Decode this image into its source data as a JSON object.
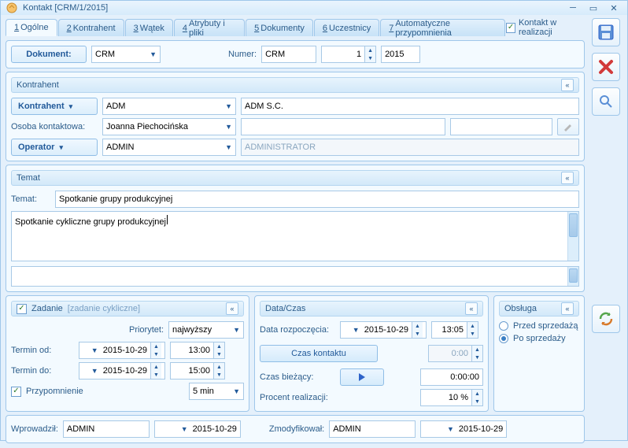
{
  "window": {
    "title": "Kontakt [CRM/1/2015]"
  },
  "realization": {
    "label": "Kontakt w realizacji",
    "checked": true
  },
  "tabs": [
    {
      "num": "1",
      "label": "Ogólne"
    },
    {
      "num": "2",
      "label": "Kontrahent"
    },
    {
      "num": "3",
      "label": "Wątek"
    },
    {
      "num": "4",
      "label": "Atrybuty i pliki"
    },
    {
      "num": "5",
      "label": "Dokumenty"
    },
    {
      "num": "6",
      "label": "Uczestnicy"
    },
    {
      "num": "7",
      "label": "Automatyczne przypomnienia"
    }
  ],
  "doc": {
    "dokument_label": "Dokument:",
    "dokument_value": "CRM",
    "numer_label": "Numer:",
    "numer_series": "CRM",
    "numer_value": "1",
    "year": "2015"
  },
  "kontrahent": {
    "header": "Kontrahent",
    "kontrahent_btn": "Kontrahent",
    "kontrahent_code": "ADM",
    "kontrahent_name": "ADM S.C.",
    "osoba_label": "Osoba kontaktowa:",
    "osoba_value": "Joanna Piechocińska",
    "operator_btn": "Operator",
    "operator_code": "ADMIN",
    "operator_name": "ADMINISTRATOR"
  },
  "temat": {
    "header": "Temat",
    "label": "Temat:",
    "value": "Spotkanie grupy produkcyjnej",
    "body": "Spotkanie cykliczne grupy produkcyjnej"
  },
  "zadanie": {
    "header": "Zadanie",
    "subheader": "[zadanie cykliczne]",
    "checked": true,
    "priorytet_label": "Priorytet:",
    "priorytet_value": "najwyższy",
    "termin_od_label": "Termin od:",
    "termin_od_date": "2015-10-29",
    "termin_od_time": "13:00",
    "termin_do_label": "Termin do:",
    "termin_do_date": "2015-10-29",
    "termin_do_time": "15:00",
    "przypomnienie_label": "Przypomnienie",
    "przypomnienie_checked": true,
    "przypomnienie_value": "5 min"
  },
  "dataczas": {
    "header": "Data/Czas",
    "rozp_label": "Data rozpoczęcia:",
    "rozp_date": "2015-10-29",
    "rozp_time": "13:05",
    "czas_kontaktu_btn": "Czas kontaktu",
    "czas_kontaktu_val": "0:00",
    "biezacy_label": "Czas bieżący:",
    "biezacy_val": "0:00:00",
    "procent_label": "Procent realizacji:",
    "procent_val": "10 %"
  },
  "obsluga": {
    "header": "Obsługa",
    "przed": "Przed sprzedażą",
    "po": "Po sprzedaży",
    "selected": "po"
  },
  "footer": {
    "wprowadzil_label": "Wprowadził:",
    "wprowadzil_user": "ADMIN",
    "wprowadzil_date": "2015-10-29",
    "zmod_label": "Zmodyfikował:",
    "zmod_user": "ADMIN",
    "zmod_date": "2015-10-29"
  }
}
